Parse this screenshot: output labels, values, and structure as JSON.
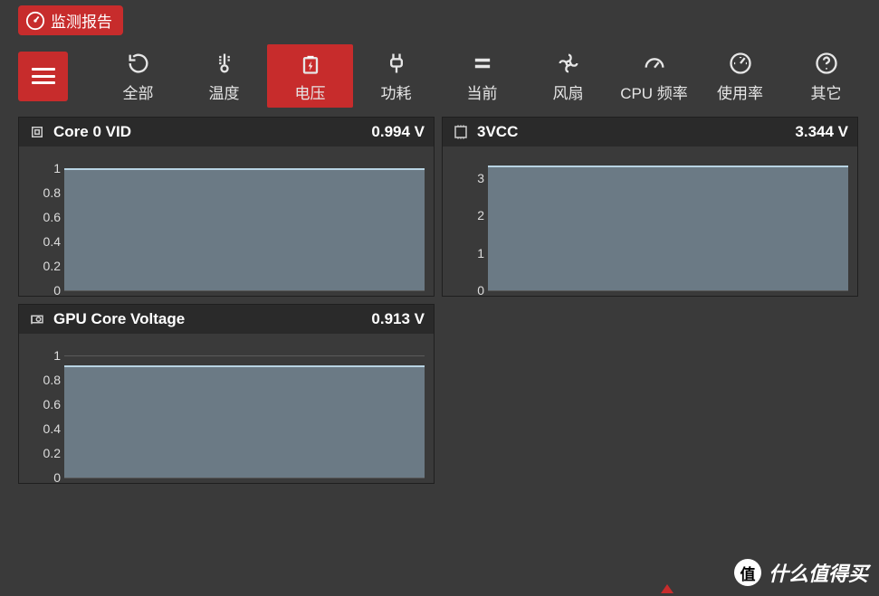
{
  "app": {
    "title": "监测报告"
  },
  "tabs": [
    {
      "key": "all",
      "label": "全部"
    },
    {
      "key": "temp",
      "label": "温度"
    },
    {
      "key": "voltage",
      "label": "电压"
    },
    {
      "key": "power",
      "label": "功耗"
    },
    {
      "key": "current",
      "label": "当前"
    },
    {
      "key": "fan",
      "label": "风扇"
    },
    {
      "key": "cpuFreq",
      "label": "CPU 频率"
    },
    {
      "key": "usage",
      "label": "使用率"
    },
    {
      "key": "other",
      "label": "其它"
    }
  ],
  "active_tab": "voltage",
  "cards": {
    "core0vid": {
      "title": "Core 0 VID",
      "value": "0.994 V"
    },
    "vcc3": {
      "title": "3VCC",
      "value": "3.344 V"
    },
    "gpuCore": {
      "title": "GPU Core Voltage",
      "value": "0.913 V"
    }
  },
  "watermark": {
    "badge": "值",
    "text": "什么值得买"
  },
  "chart_data": [
    {
      "type": "area",
      "title": "Core 0 VID",
      "ylabel": "V",
      "ylim": [
        0,
        1.1
      ],
      "yticks": [
        0,
        0.2,
        0.4,
        0.6,
        0.8,
        1
      ],
      "current_value": 0.994,
      "series": [
        {
          "name": "Core 0 VID",
          "constant": 0.994
        }
      ]
    },
    {
      "type": "area",
      "title": "3VCC",
      "ylabel": "V",
      "ylim": [
        0,
        3.6
      ],
      "yticks": [
        0,
        1,
        2,
        3
      ],
      "current_value": 3.344,
      "series": [
        {
          "name": "3VCC",
          "constant": 3.344
        }
      ]
    },
    {
      "type": "area",
      "title": "GPU Core Voltage",
      "ylabel": "V",
      "ylim": [
        0,
        1.1
      ],
      "yticks": [
        0,
        0.2,
        0.4,
        0.6,
        0.8,
        1
      ],
      "current_value": 0.913,
      "series": [
        {
          "name": "GPU Core Voltage",
          "constant": 0.913
        }
      ]
    }
  ]
}
